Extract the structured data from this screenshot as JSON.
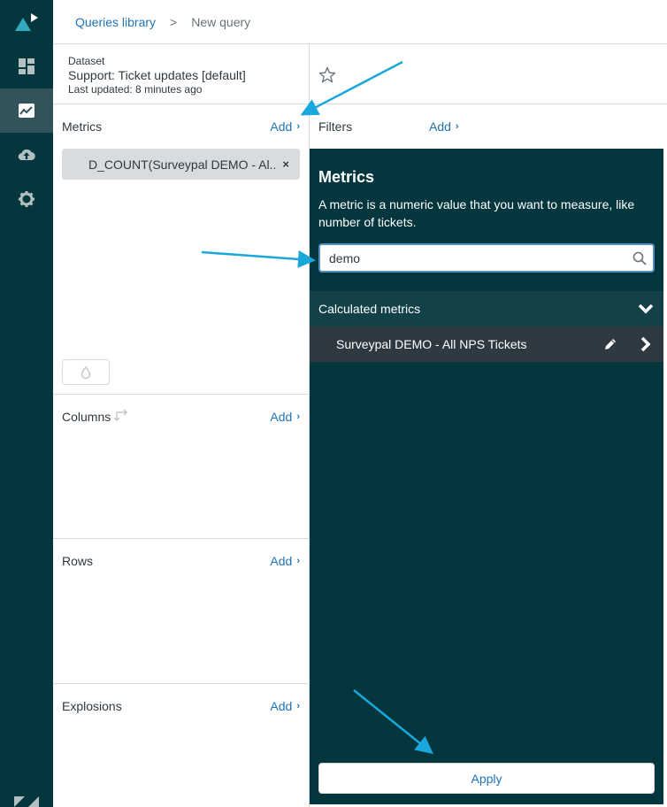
{
  "breadcrumb": {
    "link": "Queries library",
    "separator": ">",
    "current": "New query"
  },
  "dataset": {
    "label": "Dataset",
    "name": "Support: Ticket updates [default]",
    "updated": "Last updated: 8 minutes ago"
  },
  "sections": {
    "metrics": {
      "title": "Metrics",
      "add": "Add"
    },
    "columns": {
      "title": "Columns",
      "add": "Add"
    },
    "rows": {
      "title": "Rows",
      "add": "Add"
    },
    "explosions": {
      "title": "Explosions",
      "add": "Add"
    }
  },
  "metric_pill": {
    "label": "D_COUNT(Surveypal DEMO - Al...",
    "remove": "×"
  },
  "filters": {
    "title": "Filters",
    "add": "Add"
  },
  "metrics_panel": {
    "title": "Metrics",
    "description": "A metric is a numeric value that you want to measure, like number of tickets.",
    "search_value": "demo",
    "group": "Calculated metrics",
    "item": "Surveypal DEMO - All NPS Tickets",
    "apply": "Apply"
  },
  "rail": {
    "items": [
      "dashboard-icon",
      "queries-icon",
      "upload-icon",
      "settings-icon"
    ],
    "active": "queries-icon"
  },
  "colors": {
    "rail": "#03363d",
    "panel": "#03363d",
    "accent": "#1f73b7",
    "annotation_arrow": "#1aa7dc"
  }
}
